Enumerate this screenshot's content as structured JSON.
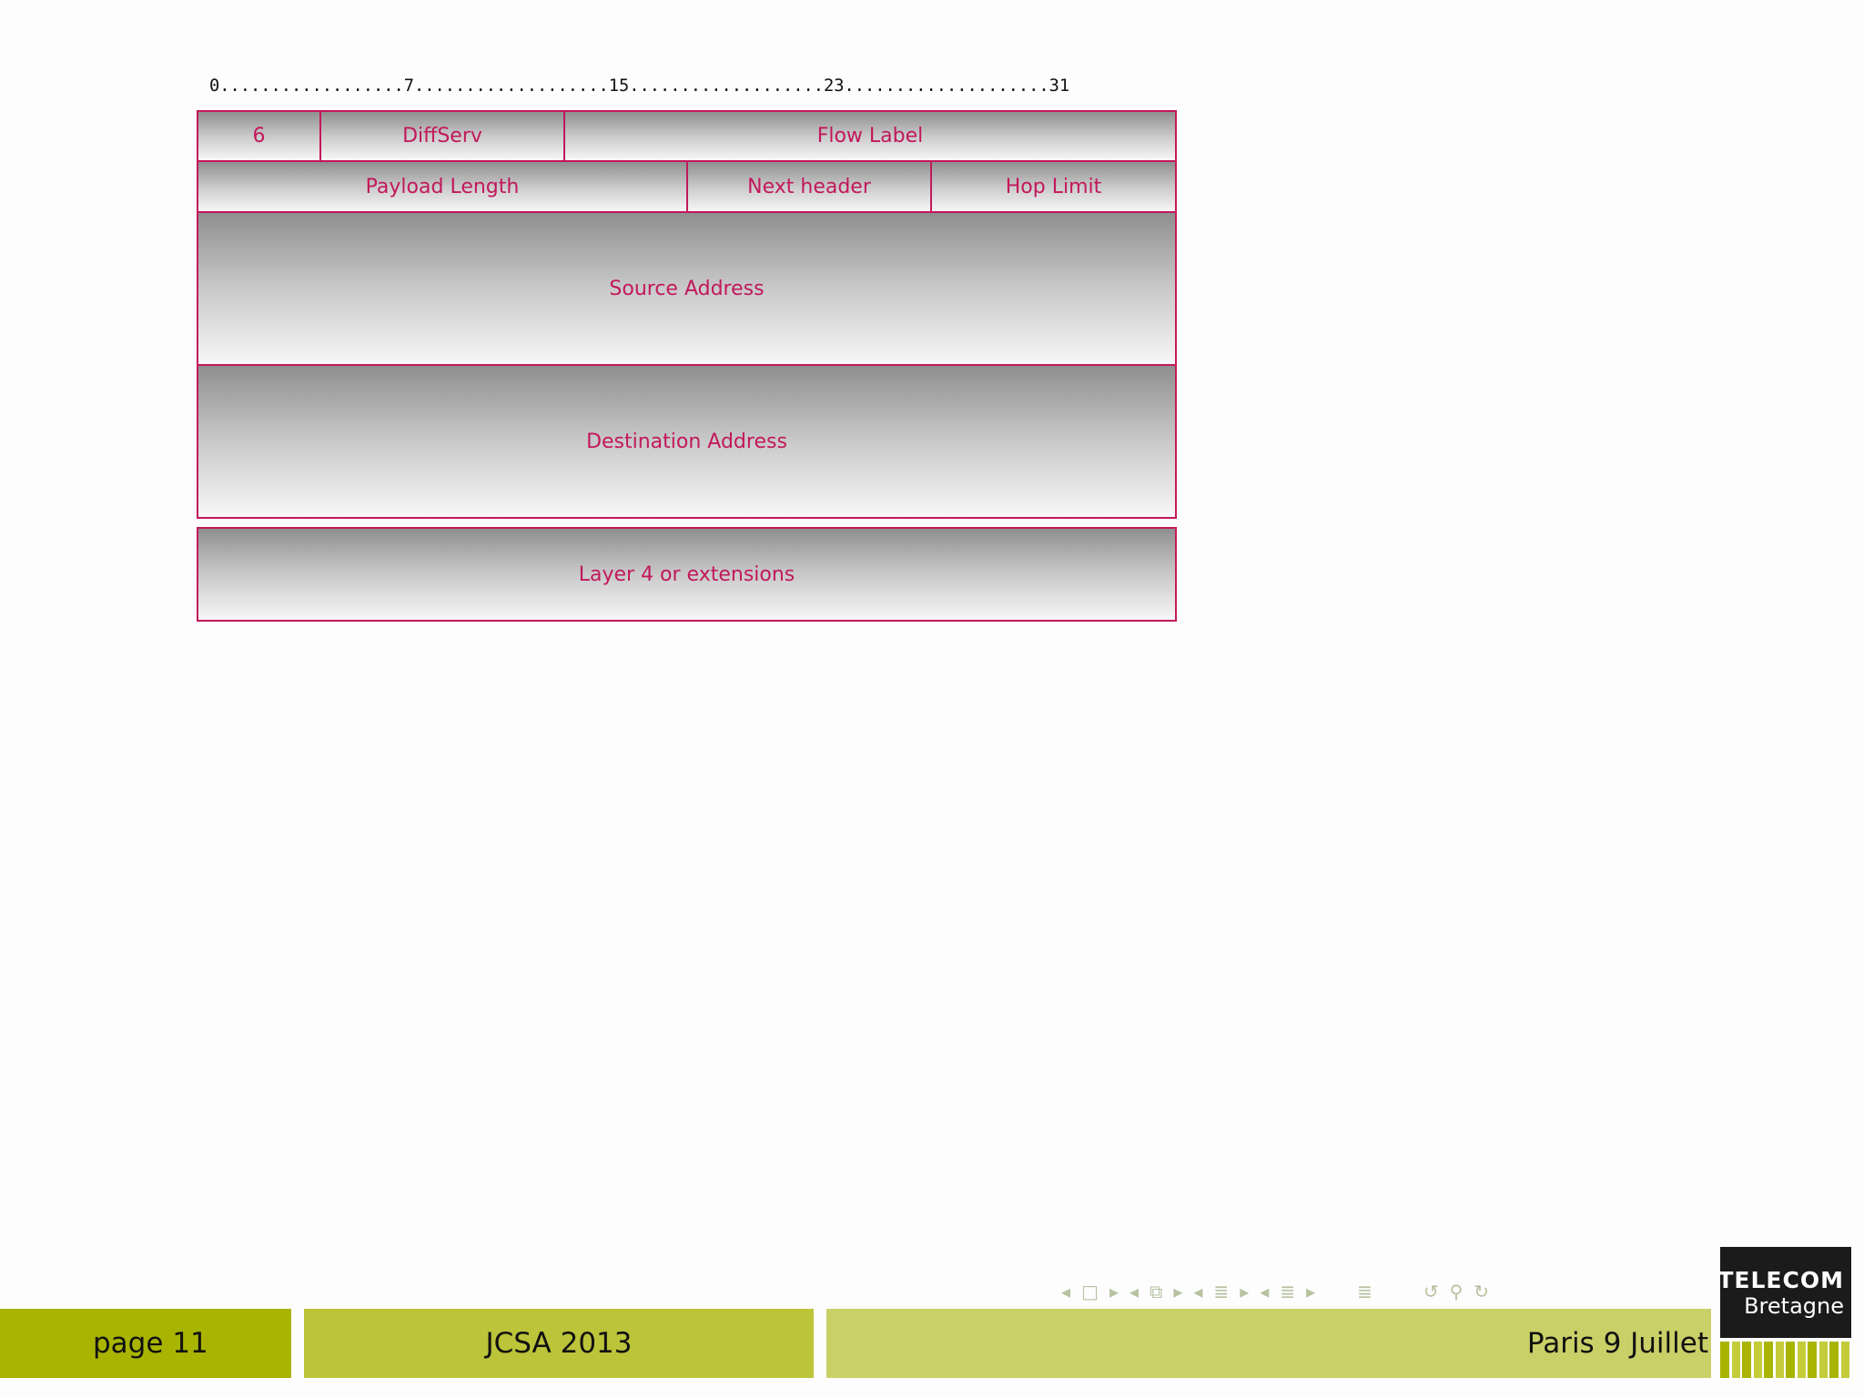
{
  "ruler": "0..................7...................15...................23....................31",
  "header_fields": [
    {
      "label": "6"
    },
    {
      "label": "DiffServ"
    },
    {
      "label": "Flow Label"
    },
    {
      "label": "Payload Length"
    },
    {
      "label": "Next header"
    },
    {
      "label": "Hop Limit"
    },
    {
      "label": "Source Address"
    },
    {
      "label": "Destination Address"
    }
  ],
  "payload": {
    "label": "Layer 4 or extensions"
  },
  "footer": {
    "page": "page 11",
    "event": "JCSA 2013",
    "place": "Paris 9 Juillet"
  },
  "logo": {
    "line1": "TELECOM",
    "line2": "Bretagne"
  },
  "colors": {
    "field_border": "#c2185b",
    "field_text": "#c2185b",
    "footer_dark": "#a8b400",
    "footer_mid": "#bcc43a",
    "footer_light": "#c9d068"
  },
  "nav_icons": [
    "nav-left-icon",
    "frame-icon",
    "nav-right-icon",
    "nav-left-icon",
    "section-icon",
    "nav-right-icon",
    "nav-left-icon",
    "subsection-icon",
    "nav-right-icon",
    "nav-left-icon",
    "subsubsection-icon",
    "nav-right-icon",
    "outline-icon",
    "undo-icon",
    "search-icon",
    "redo-icon"
  ]
}
